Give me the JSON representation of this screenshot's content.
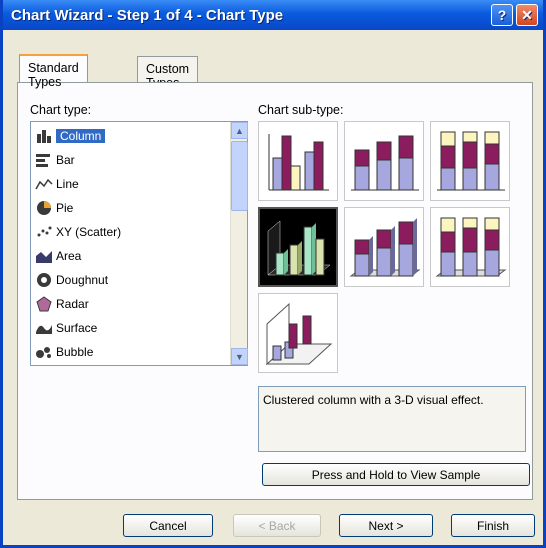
{
  "window": {
    "title": "Chart Wizard - Step 1 of 4 - Chart Type",
    "help_label": "?",
    "close_label": "✕"
  },
  "tabs": [
    {
      "label": "Standard Types",
      "active": true
    },
    {
      "label": "Custom Types",
      "active": false
    }
  ],
  "chart_type": {
    "label": "Chart type:",
    "items": [
      {
        "label": "Column",
        "selected": true,
        "icon": "column-chart-icon"
      },
      {
        "label": "Bar",
        "selected": false,
        "icon": "bar-chart-icon"
      },
      {
        "label": "Line",
        "selected": false,
        "icon": "line-chart-icon"
      },
      {
        "label": "Pie",
        "selected": false,
        "icon": "pie-chart-icon"
      },
      {
        "label": "XY (Scatter)",
        "selected": false,
        "icon": "scatter-chart-icon"
      },
      {
        "label": "Area",
        "selected": false,
        "icon": "area-chart-icon"
      },
      {
        "label": "Doughnut",
        "selected": false,
        "icon": "doughnut-chart-icon"
      },
      {
        "label": "Radar",
        "selected": false,
        "icon": "radar-chart-icon"
      },
      {
        "label": "Surface",
        "selected": false,
        "icon": "surface-chart-icon"
      },
      {
        "label": "Bubble",
        "selected": false,
        "icon": "bubble-chart-icon"
      }
    ]
  },
  "sub_type": {
    "label": "Chart sub-type:",
    "items": [
      {
        "name": "clustered-column",
        "selected": false
      },
      {
        "name": "stacked-column",
        "selected": false
      },
      {
        "name": "100-stacked-column",
        "selected": false
      },
      {
        "name": "clustered-column-3d-effect",
        "selected": true
      },
      {
        "name": "stacked-column-3d-effect",
        "selected": false
      },
      {
        "name": "100-stacked-column-3d-effect",
        "selected": false
      },
      {
        "name": "3d-column",
        "selected": false
      }
    ],
    "description": "Clustered column with a 3-D visual effect."
  },
  "buttons": {
    "press_hold": "Press and Hold to View Sample",
    "cancel": "Cancel",
    "back": "< Back",
    "next": "Next >",
    "finish": "Finish"
  },
  "colors": {
    "accent": "#8b1d5e",
    "secondary": "#a7a7e0",
    "tertiary": "#fdf5c0",
    "selected_bar": "#a8e6c8"
  }
}
